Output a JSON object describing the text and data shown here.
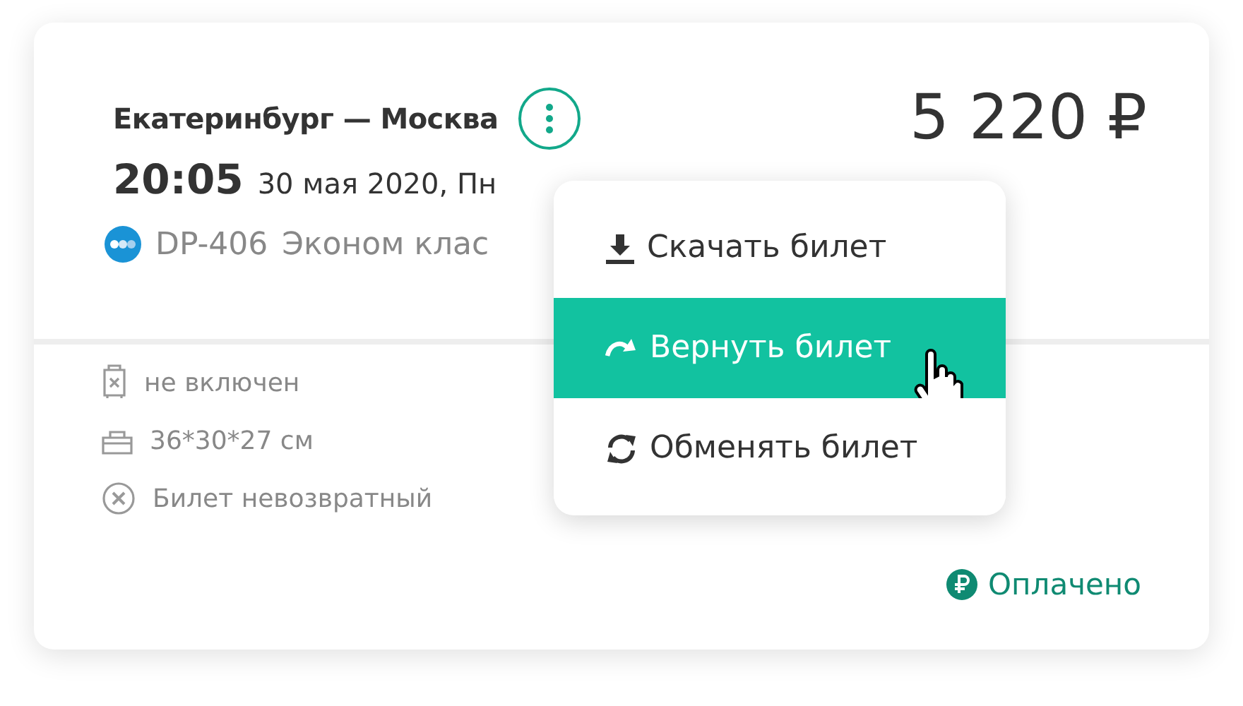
{
  "trip": {
    "route": "Екатеринбург — Москва",
    "time": "20:05",
    "date": "30 мая 2020, Пн",
    "flight": "DP-406",
    "cabin": "Эконом клас",
    "price": "5 220 ₽"
  },
  "details": [
    {
      "kind": "luggage",
      "text": "не включен"
    },
    {
      "kind": "handbag",
      "text": "36*30*27 см"
    },
    {
      "kind": "refund",
      "text": "Билет невозвратный"
    }
  ],
  "status": {
    "text": "Оплачено"
  },
  "menu": [
    {
      "kind": "download",
      "label": "Скачать билет",
      "selected": false
    },
    {
      "kind": "return",
      "label": "Вернуть билет",
      "selected": true
    },
    {
      "kind": "exchange",
      "label": "Обменять билет",
      "selected": false
    }
  ]
}
